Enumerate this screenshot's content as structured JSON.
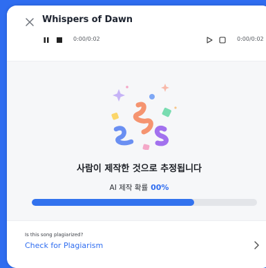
{
  "header": {
    "title": "Whispers of Dawn",
    "player_left": {
      "time": "0:00/0:02",
      "icons": [
        "pause-icon",
        "stop-icon"
      ]
    },
    "player_right": {
      "time": "0:00/0:02",
      "icons": [
        "play-icon",
        "stop-icon"
      ]
    }
  },
  "result": {
    "headline": "사람이 제작한 것으로 추정됩니다",
    "probability_label": "AI 제작 확률",
    "probability_value": "00%",
    "progress_fraction": 0.72
  },
  "footer": {
    "question": "Is this song plagiarized?",
    "link": "Check for Plagiarism",
    "icon": "chevron-right-icon"
  },
  "colors": {
    "accent": "#2f6df0",
    "background": "#2f6df0",
    "panel": "#ffffff",
    "body": "#f6f7f9"
  }
}
